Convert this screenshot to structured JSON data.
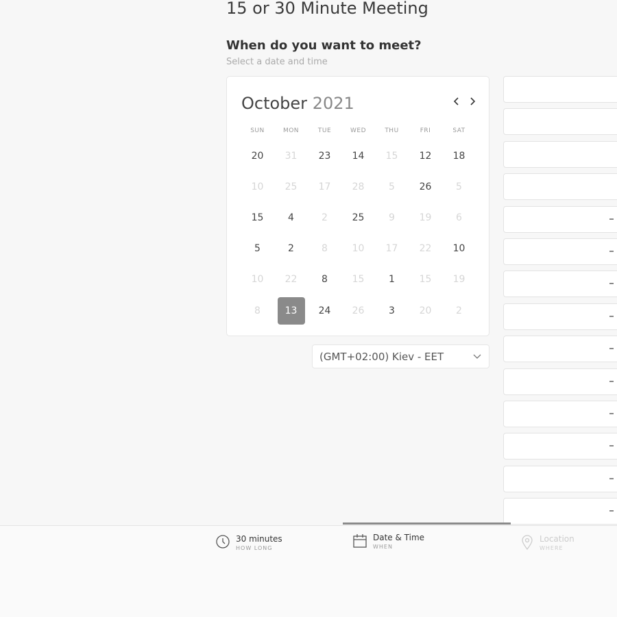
{
  "page": {
    "title": "15 or 30 Minute Meeting",
    "heading": "When do you want to meet?",
    "subheading": "Select a date and time"
  },
  "calendar": {
    "month": "October",
    "year": "2021",
    "prev_icon": "chevron-left-icon",
    "next_icon": "chevron-right-icon",
    "weekdays": [
      "SUN",
      "MON",
      "TUE",
      "WED",
      "THU",
      "FRI",
      "SAT"
    ],
    "weeks": [
      [
        {
          "d": "20",
          "s": "available"
        },
        {
          "d": "31",
          "s": "unavailable"
        },
        {
          "d": "23",
          "s": "available"
        },
        {
          "d": "14",
          "s": "available"
        },
        {
          "d": "15",
          "s": "unavailable"
        },
        {
          "d": "12",
          "s": "available"
        },
        {
          "d": "18",
          "s": "available"
        }
      ],
      [
        {
          "d": "10",
          "s": "unavailable"
        },
        {
          "d": "25",
          "s": "unavailable"
        },
        {
          "d": "17",
          "s": "unavailable"
        },
        {
          "d": "28",
          "s": "unavailable"
        },
        {
          "d": "5",
          "s": "unavailable"
        },
        {
          "d": "26",
          "s": "available"
        },
        {
          "d": "5",
          "s": "unavailable"
        }
      ],
      [
        {
          "d": "15",
          "s": "available"
        },
        {
          "d": "4",
          "s": "available"
        },
        {
          "d": "2",
          "s": "unavailable"
        },
        {
          "d": "25",
          "s": "available"
        },
        {
          "d": "9",
          "s": "unavailable"
        },
        {
          "d": "19",
          "s": "unavailable"
        },
        {
          "d": "6",
          "s": "unavailable"
        }
      ],
      [
        {
          "d": "5",
          "s": "available"
        },
        {
          "d": "2",
          "s": "available"
        },
        {
          "d": "8",
          "s": "unavailable"
        },
        {
          "d": "10",
          "s": "unavailable"
        },
        {
          "d": "17",
          "s": "unavailable"
        },
        {
          "d": "22",
          "s": "unavailable"
        },
        {
          "d": "10",
          "s": "available"
        }
      ],
      [
        {
          "d": "10",
          "s": "unavailable"
        },
        {
          "d": "22",
          "s": "unavailable"
        },
        {
          "d": "8",
          "s": "available"
        },
        {
          "d": "15",
          "s": "unavailable"
        },
        {
          "d": "1",
          "s": "available"
        },
        {
          "d": "15",
          "s": "unavailable"
        },
        {
          "d": "19",
          "s": "unavailable"
        }
      ],
      [
        {
          "d": "8",
          "s": "unavailable"
        },
        {
          "d": "13",
          "s": "selected"
        },
        {
          "d": "24",
          "s": "available"
        },
        {
          "d": "26",
          "s": "unavailable"
        },
        {
          "d": "3",
          "s": "available"
        },
        {
          "d": "20",
          "s": "unavailable"
        },
        {
          "d": "2",
          "s": "unavailable"
        }
      ]
    ]
  },
  "timezone": {
    "value": "(GMT+02:00) Kiev - EET",
    "icon": "chevron-down-icon"
  },
  "time_slots_count": 14,
  "steps": [
    {
      "label": "30 minutes",
      "sub": "HOW LONG",
      "icon": "clock-icon",
      "state": "done"
    },
    {
      "label": "Date & Time",
      "sub": "WHEN",
      "icon": "calendar-icon",
      "state": "active"
    },
    {
      "label": "Location",
      "sub": "WHERE",
      "icon": "location-pin-icon",
      "state": "disabled"
    }
  ],
  "colors": {
    "background": "#f7f7f7",
    "selected_day": "#8a8a8a",
    "progress": "#8a8a8a"
  }
}
